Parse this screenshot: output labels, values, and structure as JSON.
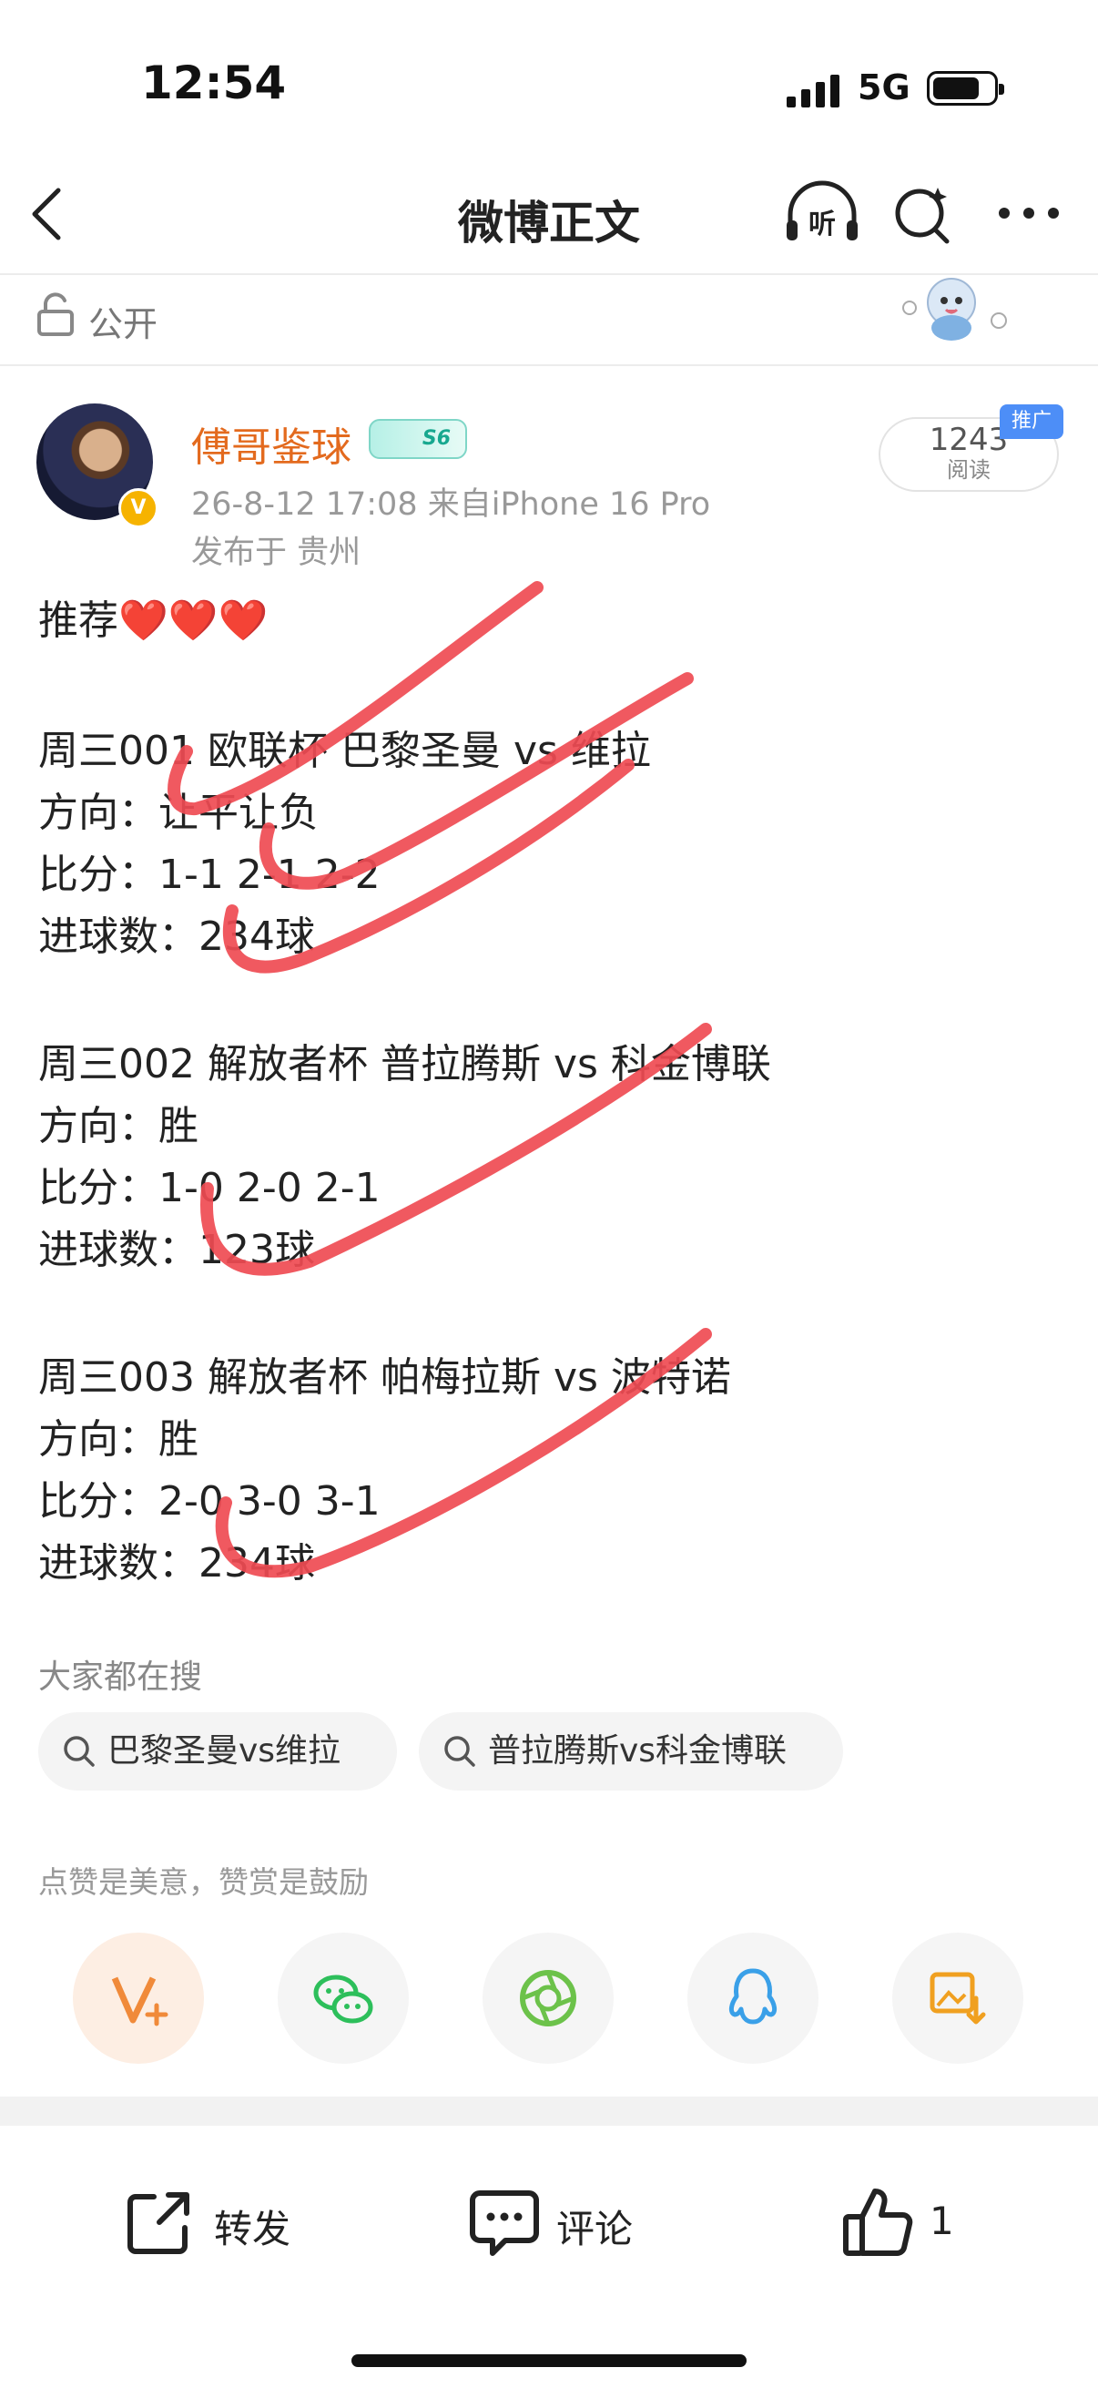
{
  "status_bar": {
    "time": "12:54",
    "network": "5G"
  },
  "nav": {
    "title": "微博正文"
  },
  "privacy": {
    "label": "公开"
  },
  "author": {
    "name": "傅哥鉴球",
    "level": "S6",
    "post_meta": "26-8-12 17:08  来自iPhone 16 Pro",
    "location": "发布于 贵州",
    "views_count": "1243",
    "views_label": "阅读",
    "promo_tag": "推广"
  },
  "post": {
    "intro": "推荐❤️❤️❤️",
    "matches": [
      {
        "title": "周三001 欧联杯 巴黎圣曼 vs 维拉",
        "direction": "方向：让平让负",
        "score": "比分：1-1  2-1  2-2",
        "goals": "进球数：234球"
      },
      {
        "title": "周三002 解放者杯 普拉腾斯 vs 科金博联",
        "direction": "方向：胜",
        "score": "比分：1-0  2-0  2-1",
        "goals": "进球数：123球"
      },
      {
        "title": "周三003 解放者杯 帕梅拉斯 vs 波特诺",
        "direction": "方向：胜",
        "score": "比分：2-0  3-0  3-1",
        "goals": "进球数：234球"
      }
    ]
  },
  "search": {
    "title": "大家都在搜",
    "chips": [
      "巴黎圣曼vs维拉",
      "普拉腾斯vs科金博联"
    ]
  },
  "encourage": "点赞是美意，赞赏是鼓励",
  "share_icons": [
    "vplus-icon",
    "wechat-icon",
    "moments-icon",
    "qq-icon",
    "save-image-icon"
  ],
  "bottom_bar": {
    "repost": "转发",
    "comment": "评论",
    "like_count": "1"
  },
  "colors": {
    "accent": "#e36a1e",
    "scribble": "#ef4b53",
    "promo": "#4d8ef7"
  }
}
